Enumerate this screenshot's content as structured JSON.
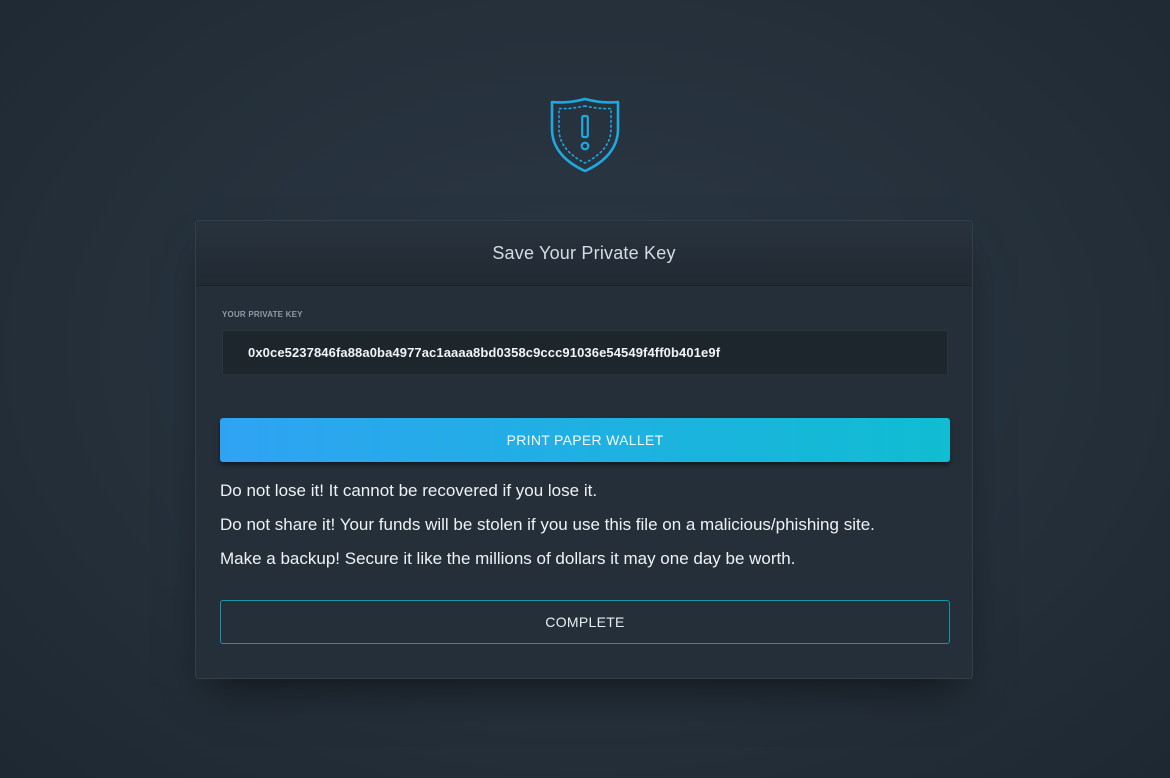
{
  "header_icon": "shield-warning-icon",
  "dialog": {
    "title": "Save Your Private Key"
  },
  "private_key": {
    "label": "YOUR PRIVATE KEY",
    "value": "0x0ce5237846fa88a0ba4977ac1aaaa8bd0358c9ccc91036e54549f4ff0b401e9f"
  },
  "print_button": {
    "label": "PRINT PAPER WALLET"
  },
  "warnings": [
    "Do not lose it! It cannot be recovered if you lose it.",
    "Do not share it! Your funds will be stolen if you use this file on a malicious/phishing site.",
    "Make a backup! Secure it like the millions of dollars it may one day be worth."
  ],
  "complete_button": {
    "label": "COMPLETE"
  },
  "colors": {
    "accent": "#1fa8e0",
    "gradient_start": "#2fa3f3",
    "gradient_end": "#10bdd2",
    "background": "#25303b",
    "card": "#252f3a"
  }
}
